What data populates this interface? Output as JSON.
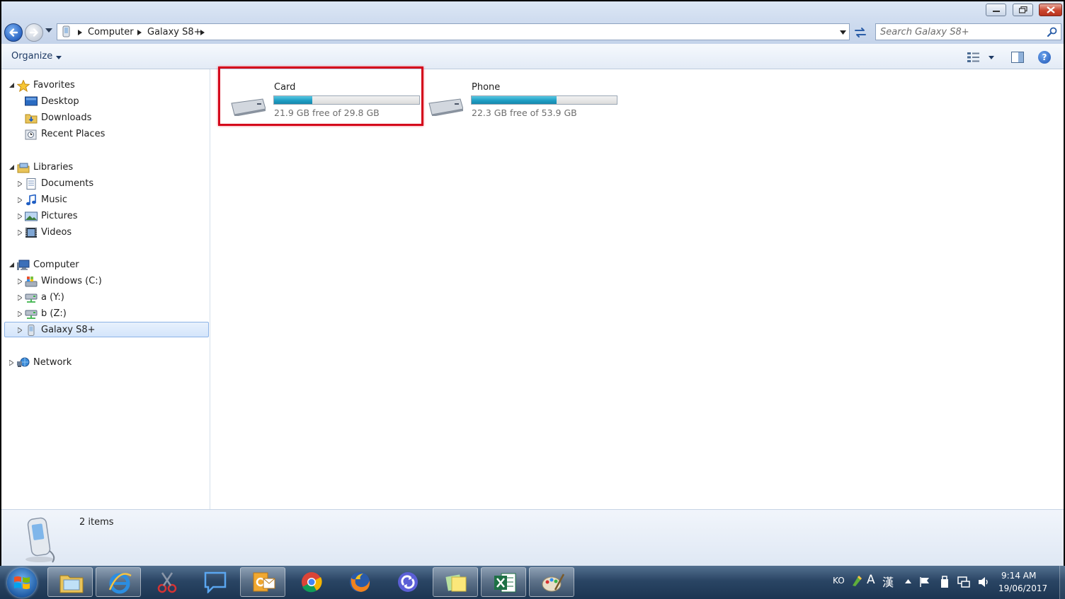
{
  "window": {
    "caption_buttons": [
      "minimize-icon",
      "restore-icon",
      "close-icon"
    ]
  },
  "address_bar": {
    "breadcrumbs": [
      "Computer",
      "Galaxy S8+"
    ]
  },
  "search": {
    "placeholder": "Search Galaxy S8+"
  },
  "command_bar": {
    "organize_label": "Organize"
  },
  "nav_pane": {
    "favorites": {
      "label": "Favorites",
      "items": [
        "Desktop",
        "Downloads",
        "Recent Places"
      ]
    },
    "libraries": {
      "label": "Libraries",
      "items": [
        "Documents",
        "Music",
        "Pictures",
        "Videos"
      ]
    },
    "computer": {
      "label": "Computer",
      "items": [
        "Windows (C:)",
        "a (Y:)",
        "b (Z:)",
        "Galaxy S8+"
      ],
      "selected": "Galaxy S8+"
    },
    "network": {
      "label": "Network"
    }
  },
  "drives": [
    {
      "name": "Card",
      "free_text": "21.9 GB free of 29.8 GB",
      "used_fraction": 0.265
    },
    {
      "name": "Phone",
      "free_text": "22.3 GB free of 53.9 GB",
      "used_fraction": 0.586
    }
  ],
  "details": {
    "item_count": "2 items"
  },
  "taskbar": {
    "apps": [
      "windows-explorer-icon",
      "internet-explorer-icon",
      "snipping-tool-icon",
      "chat-icon",
      "outlook-icon",
      "chrome-icon",
      "firefox-icon",
      "sync-app-icon",
      "sticky-notes-icon",
      "excel-icon",
      "paint-icon"
    ],
    "tray": {
      "language": "KO",
      "ime_mode": "A",
      "ime_hanja": "漢",
      "time": "9:14 AM",
      "date": "19/06/2017"
    }
  },
  "colors": {
    "highlight": "#d4061b",
    "capacity_bar": "#1f9ec4",
    "selection": "#d4e5fb"
  }
}
